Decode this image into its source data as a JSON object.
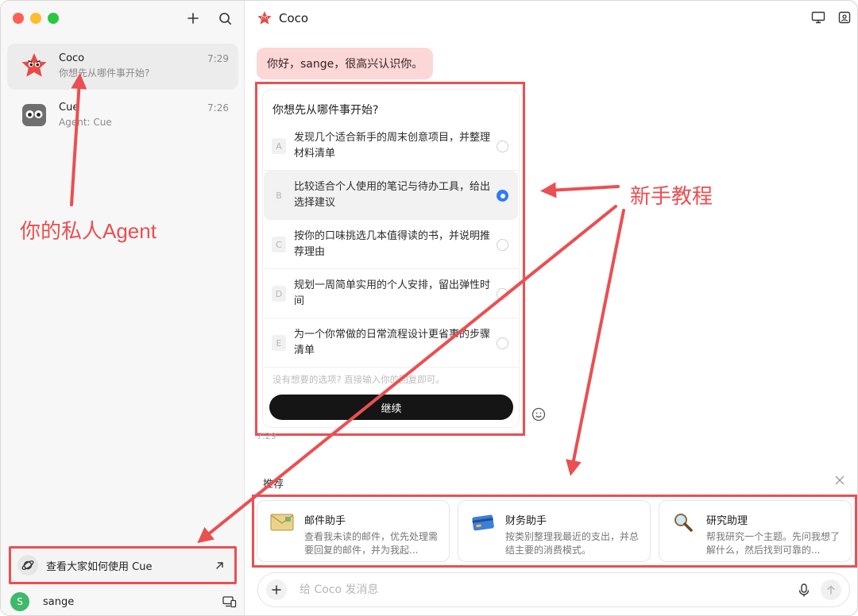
{
  "sidebar": {
    "conversations": [
      {
        "name": "Coco",
        "subtitle": "你想先从哪件事开始?",
        "time": "7:29",
        "avatar": "coco-star-avatar"
      },
      {
        "name": "Cue",
        "subtitle": "Agent: Cue",
        "time": "7:26",
        "avatar": "cue-owl-avatar"
      }
    ],
    "howto_label": "查看大家如何使用 Cue",
    "user": {
      "initial": "S",
      "name": "sange"
    }
  },
  "header": {
    "title": "Coco"
  },
  "chat": {
    "greeting": "你好，sange，很高兴认识你。",
    "question": "你想先从哪件事开始?",
    "options": [
      {
        "letter": "A",
        "text": "发现几个适合新手的周末创意项目，并整理材料清单",
        "selected": false
      },
      {
        "letter": "B",
        "text": "比较适合个人使用的笔记与待办工具，给出选择建议",
        "selected": true
      },
      {
        "letter": "C",
        "text": "按你的口味挑选几本值得读的书，并说明推荐理由",
        "selected": false
      },
      {
        "letter": "D",
        "text": "规划一周简单实用的个人安排，留出弹性时间",
        "selected": false
      },
      {
        "letter": "E",
        "text": "为一个你常做的日常流程设计更省事的步骤清单",
        "selected": false
      }
    ],
    "hint": "没有想要的选项? 直接输入你的回复即可。",
    "continue_label": "继续",
    "time": "7:29"
  },
  "recommend": {
    "title": "推荐",
    "items": [
      {
        "name": "邮件助手",
        "desc": "查看我未读的邮件，优先处理需要回复的邮件，并为我起...",
        "icon": "mail-icon"
      },
      {
        "name": "财务助手",
        "desc": "按类别整理我最近的支出，并总结主要的消费模式。",
        "icon": "credit-card-icon"
      },
      {
        "name": "研究助理",
        "desc": "帮我研究一个主题。先问我想了解什么，然后找到可靠的...",
        "icon": "magnifier-icon"
      }
    ]
  },
  "composer": {
    "placeholder": "给 Coco 发消息"
  },
  "annotations": {
    "agent_label": "你的私人Agent",
    "tutorial_label": "新手教程",
    "color": "#ea4f52"
  }
}
